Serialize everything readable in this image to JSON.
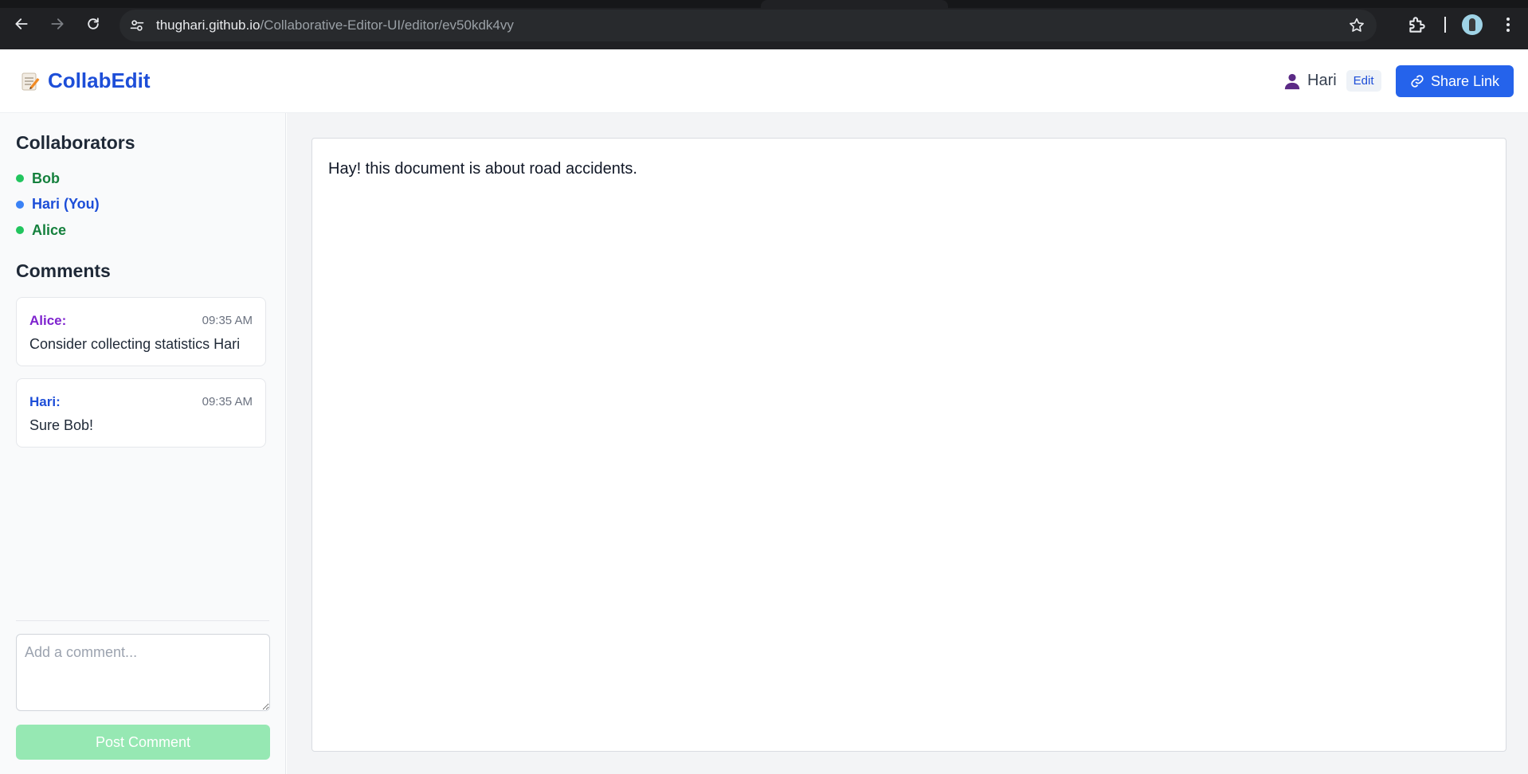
{
  "browser": {
    "url_host": "thughari.github.io",
    "url_path": "/Collaborative-Editor-UI/editor/ev50kdk4vy"
  },
  "header": {
    "logo_icon": "memo-icon",
    "app_title": "CollabEdit",
    "user_name": "Hari",
    "user_role": "Edit",
    "share_label": "Share Link"
  },
  "sidebar": {
    "collaborators_title": "Collaborators",
    "collaborators": [
      {
        "name": "Bob",
        "color": "#15803d",
        "dot": "#22c55e"
      },
      {
        "name": "Hari (You)",
        "color": "#1d4ed8",
        "dot": "#3b82f6"
      },
      {
        "name": "Alice",
        "color": "#15803d",
        "dot": "#22c55e"
      }
    ],
    "comments_title": "Comments",
    "comments": [
      {
        "author": "Alice:",
        "time": "09:35 AM",
        "text": "Consider collecting statistics Hari",
        "color": "#7e22ce"
      },
      {
        "author": "Hari:",
        "time": "09:35 AM",
        "text": "Sure Bob!",
        "color": "#1d4ed8"
      }
    ],
    "comment_placeholder": "Add a comment...",
    "post_label": "Post Comment"
  },
  "editor": {
    "content": "Hay! this document is about road accidents."
  },
  "colors": {
    "primary": "#2563eb",
    "post_disabled": "#96e8b3"
  }
}
